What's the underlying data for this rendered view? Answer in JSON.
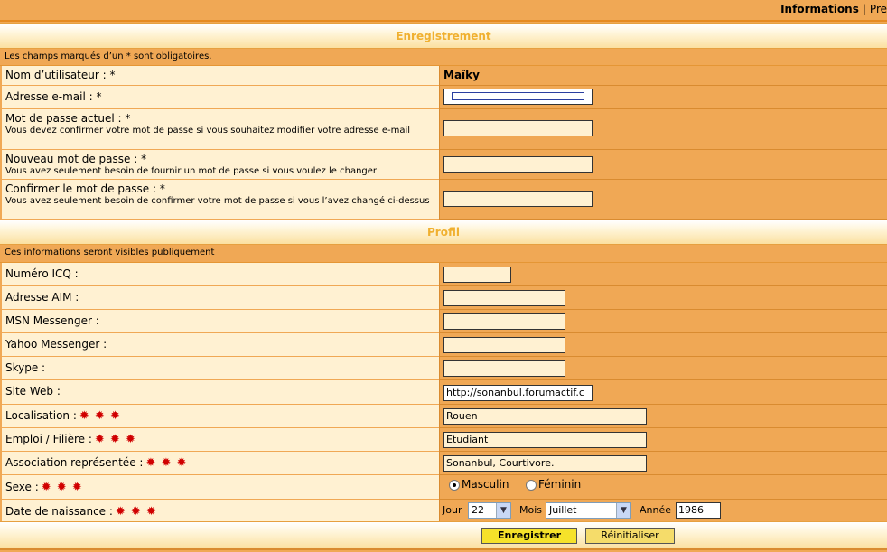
{
  "topbar": {
    "active": "Informations",
    "next": "Pre"
  },
  "registration": {
    "title": "Enregistrement",
    "note": "Les champs marqués d’un * sont obligatoires.",
    "username_label": "Nom d’utilisateur : *",
    "username_value": "Maïky",
    "email_label": "Adresse e-mail : *",
    "current_pw_label": "Mot de passe actuel : *",
    "current_pw_help": "Vous devez confirmer votre mot de passe si vous souhaitez modifier votre adresse e-mail",
    "new_pw_label": "Nouveau mot de passe : *",
    "new_pw_help": "Vous avez seulement besoin de fournir un mot de passe si vous voulez le changer",
    "confirm_pw_label": "Confirmer le mot de passe : *",
    "confirm_pw_help": "Vous avez seulement besoin de confirmer votre mot de passe si vous l’avez changé ci-dessus"
  },
  "profile": {
    "title": "Profil",
    "note": "Ces informations seront visibles publiquement",
    "icq_label": "Numéro ICQ :",
    "aim_label": "Adresse AIM :",
    "msn_label": "MSN Messenger :",
    "yahoo_label": "Yahoo Messenger :",
    "skype_label": "Skype :",
    "website_label": "Site Web :",
    "website_value": "http://sonanbul.forumactif.c",
    "location_label": "Localisation :",
    "location_value": "Rouen",
    "job_label": "Emploi / Filière :",
    "job_value": "Etudiant",
    "association_label": "Association représentée :",
    "association_value": "Sonanbul, Courtivore.",
    "gender_label": "Sexe :",
    "gender_male": "Masculin",
    "gender_female": "Féminin",
    "birth_label": "Date de naissance :",
    "day_label": "Jour",
    "day_value": "22",
    "month_label": "Mois",
    "month_value": "Juillet",
    "year_label": "Année",
    "year_value": "1986",
    "stars": "✹ ✹ ✹"
  },
  "buttons": {
    "submit": "Enregistrer",
    "reset": "Réinitialiser"
  },
  "colors": {
    "background": "#f0a855",
    "label_cell": "#fff1d2",
    "section_title": "#f0b030",
    "required_star": "#d00000"
  }
}
